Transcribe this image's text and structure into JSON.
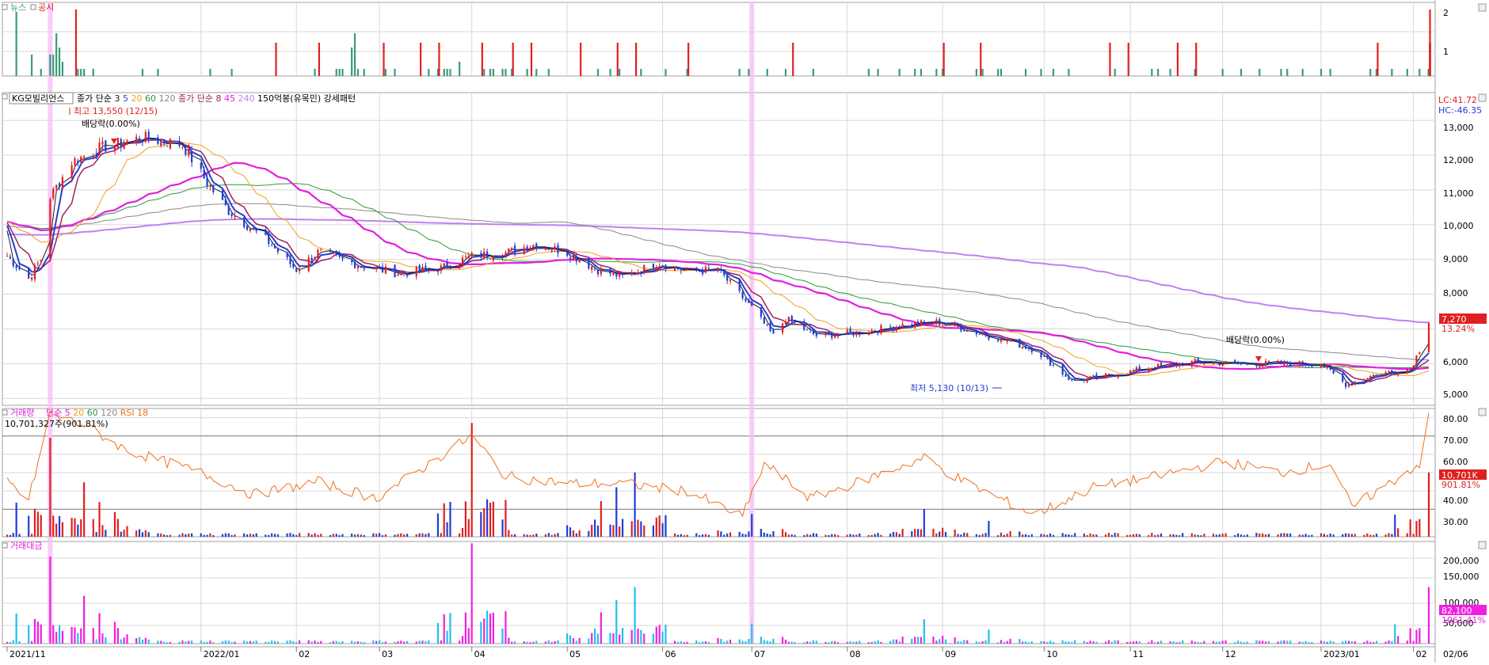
{
  "colors": {
    "up": "#e02020",
    "down": "#1e3fd6",
    "news": "#3a9a7a",
    "disclosure": "#e02020",
    "ma3": "#1a1a1a",
    "ma5": "#2a3fd0",
    "ma20": "#f0a020",
    "ma60": "#2a9a3a",
    "ma120": "#888888",
    "ma8": "#a02060",
    "ma45": "#e020e0",
    "ma240": "#c080f0",
    "rsi": "#f07020",
    "trading_value": "#f020e0",
    "trading_value_down": "#20c0f0",
    "highlight": "#f8c0f8",
    "grid": "#d8d8d8"
  },
  "panels": {
    "news": {
      "labels": [
        "뉴스",
        "공시"
      ],
      "y_ticks": [
        "2",
        "1"
      ]
    },
    "price": {
      "stock_name": "KG모빌리언스",
      "legend": [
        {
          "text": "종가 단순",
          "color": "#000000"
        },
        {
          "text": "3",
          "color": "#1a1a1a"
        },
        {
          "text": "5",
          "color": "#2a3fd0"
        },
        {
          "text": "20",
          "color": "#f0a020"
        },
        {
          "text": "60",
          "color": "#2a9a3a"
        },
        {
          "text": "120",
          "color": "#888888"
        },
        {
          "text": "종가 단순",
          "color": "#a02060"
        },
        {
          "text": "8",
          "color": "#a02060"
        },
        {
          "text": "45",
          "color": "#e020e0"
        },
        {
          "text": "240",
          "color": "#c080f0"
        },
        {
          "text": "150억봉(유목민) 강세패턴",
          "color": "#000000"
        }
      ],
      "annotations": {
        "high": "최고 13,550 (12/15)",
        "dividend1": "배당락(0.00%)",
        "low": "최저 5,130 (10/13)",
        "dividend2": "배당락(0.00%)"
      },
      "lc": "LC:41.72",
      "hc": "HC:-46.35",
      "current_price": "7,270",
      "current_change": "13.24%",
      "y_ticks": [
        "13,000",
        "12,000",
        "11,000",
        "10,000",
        "9,000",
        "8,000",
        "6,000",
        "5,000"
      ]
    },
    "volume": {
      "label": "거래량",
      "legend": [
        {
          "text": "단순",
          "color": "#e020e0"
        },
        {
          "text": "5",
          "color": "#e020e0"
        },
        {
          "text": "20",
          "color": "#f0a020"
        },
        {
          "text": "60",
          "color": "#2a9a3a"
        },
        {
          "text": "120",
          "color": "#888888"
        },
        {
          "text": "RSI 18",
          "color": "#f07020"
        }
      ],
      "value_text": "10,701,327주(901.81%)",
      "right_value": "10,701K",
      "right_pct": "901.81%",
      "y_ticks": [
        "80.00",
        "70.00",
        "60.00",
        "40.00",
        "30.00"
      ]
    },
    "trading_value": {
      "label": "거래대금",
      "right_value": "82,100",
      "right_pct": "1061.41%",
      "y_ticks": [
        "200,000",
        "150,000",
        "100,000",
        "50,000"
      ]
    }
  },
  "x_axis_labels": [
    "2021/11",
    "2022/01",
    "02",
    "03",
    "04",
    "05",
    "06",
    "07",
    "08",
    "09",
    "10",
    "11",
    "12",
    "2023/01",
    "02",
    "02/06"
  ],
  "chart_data": [
    {
      "type": "bar",
      "title": "",
      "series": [
        {
          "name": "뉴스",
          "points": [
            [
              3,
              9
            ],
            [
              6,
              3
            ],
            [
              9,
              1
            ],
            [
              10,
              3
            ],
            [
              11,
              3
            ],
            [
              12,
              6
            ],
            [
              13,
              4
            ],
            [
              14,
              2
            ],
            [
              17,
              1
            ],
            [
              18,
              1
            ],
            [
              19,
              1
            ],
            [
              20,
              1
            ],
            [
              32,
              1
            ],
            [
              35,
              1
            ],
            [
              48,
              1
            ],
            [
              53,
              1
            ],
            [
              72,
              1
            ],
            [
              77,
              1
            ],
            [
              78,
              1
            ],
            [
              79,
              1
            ],
            [
              80,
              4
            ],
            [
              81,
              6
            ],
            [
              82,
              1
            ],
            [
              84,
              1
            ],
            [
              89,
              1
            ],
            [
              90,
              1
            ],
            [
              99,
              1
            ],
            [
              100,
              1
            ],
            [
              102,
              1
            ],
            [
              103,
              1
            ],
            [
              104,
              1
            ],
            [
              105,
              2
            ],
            [
              111,
              1
            ],
            [
              113,
              1
            ],
            [
              114,
              1
            ],
            [
              115,
              1
            ],
            [
              116,
              1
            ],
            [
              118,
              1
            ],
            [
              121,
              1
            ],
            [
              124,
              1
            ],
            [
              126,
              1
            ],
            [
              138,
              1
            ],
            [
              140,
              1
            ],
            [
              143,
              1
            ],
            [
              148,
              1
            ],
            [
              154,
              1
            ],
            [
              159,
              1
            ],
            [
              170,
              1
            ],
            [
              173,
              1
            ],
            [
              177,
              1
            ],
            [
              181,
              1
            ],
            [
              188,
              1
            ],
            [
              200,
              1
            ],
            [
              203,
              1
            ],
            [
              208,
              1
            ],
            [
              211,
              1
            ],
            [
              213,
              1
            ],
            [
              216,
              1
            ],
            [
              218,
              1
            ],
            [
              225,
              1
            ],
            [
              227,
              1
            ],
            [
              230,
              1
            ],
            [
              231,
              1
            ],
            [
              237,
              1
            ],
            [
              240,
              1
            ],
            [
              244,
              1
            ],
            [
              247,
              1
            ],
            [
              258,
              1
            ],
            [
              266,
              1
            ],
            [
              268,
              1
            ],
            [
              270,
              1
            ],
            [
              276,
              1
            ],
            [
              283,
              1
            ],
            [
              287,
              1
            ],
            [
              291,
              1
            ],
            [
              296,
              1
            ],
            [
              298,
              1
            ],
            [
              301,
              1
            ],
            [
              305,
              1
            ],
            [
              308,
              1
            ],
            [
              317,
              1
            ],
            [
              319,
              1
            ],
            [
              322,
              1
            ],
            [
              325,
              1
            ],
            [
              329,
              1
            ],
            [
              335,
              1
            ],
            [
              338,
              1
            ],
            [
              344,
              1
            ],
            [
              348,
              1
            ],
            [
              353,
              1
            ],
            [
              356,
              1
            ],
            [
              359,
              1
            ],
            [
              363,
              1
            ],
            [
              365,
              1
            ],
            [
              368,
              1
            ],
            [
              372,
              1
            ],
            [
              374,
              1
            ],
            [
              377,
              1
            ],
            [
              381,
              1
            ],
            [
              388,
              1
            ],
            [
              393,
              1
            ],
            [
              398,
              1
            ],
            [
              402,
              1
            ],
            [
              409,
              1
            ],
            [
              412,
              1
            ],
            [
              416,
              1
            ],
            [
              421,
              1
            ],
            [
              425,
              1
            ],
            [
              428,
              1
            ],
            [
              433,
              1
            ],
            [
              438,
              1
            ],
            [
              442,
              1
            ],
            [
              448,
              1
            ],
            [
              451,
              1
            ],
            [
              455,
              1
            ],
            [
              461,
              1
            ],
            [
              467,
              1
            ],
            [
              470,
              1
            ],
            [
              474,
              1
            ],
            [
              479,
              1
            ]
          ]
        },
        {
          "name": "공시",
          "points": [
            [
              16,
              2
            ],
            [
              63,
              1
            ],
            [
              73,
              1
            ],
            [
              88,
              1
            ],
            [
              96,
              1
            ],
            [
              100,
              1
            ],
            [
              110,
              1
            ],
            [
              118,
              1
            ],
            [
              122,
              1
            ],
            [
              134,
              1
            ],
            [
              142,
              1
            ],
            [
              146,
              1
            ],
            [
              159,
              1
            ],
            [
              183,
              1
            ],
            [
              218,
              1
            ],
            [
              226,
              1
            ],
            [
              256,
              1
            ],
            [
              260,
              1
            ],
            [
              272,
              1
            ],
            [
              276,
              1
            ],
            [
              319,
              1
            ],
            [
              340,
              1
            ],
            [
              345,
              1
            ],
            [
              390,
              1
            ],
            [
              394,
              1
            ],
            [
              398,
              1
            ],
            [
              401,
              1
            ],
            [
              447,
              2
            ]
          ]
        }
      ]
    },
    {
      "type": "line",
      "title": "",
      "x_start": "2021-11-01",
      "x_end": "2023-02-06",
      "ylim": [
        4800,
        13800
      ],
      "price_keyframes": [
        [
          "2021-11-01",
          9100
        ],
        [
          "2021-11-08",
          8450
        ],
        [
          "2021-11-12",
          9000
        ],
        [
          "2021-11-15",
          10800
        ],
        [
          "2021-11-22",
          11800
        ],
        [
          "2021-12-01",
          12200
        ],
        [
          "2021-12-10",
          12400
        ],
        [
          "2021-12-15",
          12500
        ],
        [
          "2021-12-28",
          12300
        ],
        [
          "2022-01-05",
          11200
        ],
        [
          "2022-01-12",
          10400
        ],
        [
          "2022-01-25",
          9500
        ],
        [
          "2022-02-03",
          8700
        ],
        [
          "2022-02-10",
          9200
        ],
        [
          "2022-02-25",
          8800
        ],
        [
          "2022-03-08",
          8600
        ],
        [
          "2022-03-22",
          8750
        ],
        [
          "2022-04-01",
          9100
        ],
        [
          "2022-04-12",
          9200
        ],
        [
          "2022-04-22",
          9450
        ],
        [
          "2022-05-02",
          9200
        ],
        [
          "2022-05-12",
          8700
        ],
        [
          "2022-05-20",
          8500
        ],
        [
          "2022-06-01",
          8900
        ],
        [
          "2022-06-10",
          8650
        ],
        [
          "2022-06-20",
          8700
        ],
        [
          "2022-07-01",
          7600
        ],
        [
          "2022-07-08",
          6800
        ],
        [
          "2022-07-12",
          7300
        ],
        [
          "2022-07-22",
          6800
        ],
        [
          "2022-08-05",
          6900
        ],
        [
          "2022-08-18",
          7100
        ],
        [
          "2022-08-30",
          7200
        ],
        [
          "2022-09-08",
          7000
        ],
        [
          "2022-09-20",
          6700
        ],
        [
          "2022-10-01",
          6400
        ],
        [
          "2022-10-13",
          5500
        ],
        [
          "2022-10-25",
          5650
        ],
        [
          "2022-11-08",
          5900
        ],
        [
          "2022-11-22",
          6050
        ],
        [
          "2022-12-05",
          6000
        ],
        [
          "2022-12-22",
          6000
        ],
        [
          "2023-01-02",
          6000
        ],
        [
          "2023-01-10",
          5400
        ],
        [
          "2023-01-20",
          5700
        ],
        [
          "2023-01-31",
          5850
        ],
        [
          "2023-02-03",
          6400
        ],
        [
          "2023-02-06",
          7270
        ]
      ],
      "series": [
        {
          "name": "3",
          "values": []
        },
        {
          "name": "5",
          "values": []
        },
        {
          "name": "20",
          "values": []
        },
        {
          "name": "60",
          "values": []
        },
        {
          "name": "120",
          "values": []
        },
        {
          "name": "8",
          "values": []
        },
        {
          "name": "45",
          "values": []
        },
        {
          "name": "240",
          "values": []
        }
      ]
    },
    {
      "type": "bar",
      "title": "",
      "volume_spikes": [
        [
          "2021-11-15",
          10.0
        ],
        [
          "2021-11-26",
          5.5
        ],
        [
          "2021-12-01",
          3.5
        ],
        [
          "2021-12-06",
          2.5
        ],
        [
          "2022-04-01",
          11.5
        ],
        [
          "2022-04-04",
          2.5
        ],
        [
          "2022-05-13",
          3.6
        ],
        [
          "2022-05-18",
          5.0
        ],
        [
          "2022-05-24",
          6.5
        ],
        [
          "2022-07-01",
          2.3
        ],
        [
          "2022-08-26",
          2.8
        ],
        [
          "2022-09-16",
          1.6
        ],
        [
          "2023-02-06",
          6.5
        ]
      ],
      "rsi_keyframes": [
        [
          "2021-11-01",
          45
        ],
        [
          "2021-11-08",
          35
        ],
        [
          "2021-11-15",
          82
        ],
        [
          "2021-11-26",
          76
        ],
        [
          "2021-12-10",
          62
        ],
        [
          "2022-01-03",
          50
        ],
        [
          "2022-01-20",
          38
        ],
        [
          "2022-02-10",
          45
        ],
        [
          "2022-03-01",
          36
        ],
        [
          "2022-04-01",
          70
        ],
        [
          "2022-04-12",
          48
        ],
        [
          "2022-05-02",
          44
        ],
        [
          "2022-05-20",
          44
        ],
        [
          "2022-06-10",
          40
        ],
        [
          "2022-06-28",
          26
        ],
        [
          "2022-07-05",
          55
        ],
        [
          "2022-07-20",
          36
        ],
        [
          "2022-08-05",
          45
        ],
        [
          "2022-08-26",
          58
        ],
        [
          "2022-09-08",
          45
        ],
        [
          "2022-10-01",
          27
        ],
        [
          "2022-10-20",
          42
        ],
        [
          "2022-11-10",
          48
        ],
        [
          "2022-12-01",
          56
        ],
        [
          "2022-12-20",
          50
        ],
        [
          "2023-01-05",
          55
        ],
        [
          "2023-01-12",
          31
        ],
        [
          "2023-01-25",
          45
        ],
        [
          "2023-02-03",
          55
        ],
        [
          "2023-02-06",
          80
        ]
      ]
    }
  ]
}
